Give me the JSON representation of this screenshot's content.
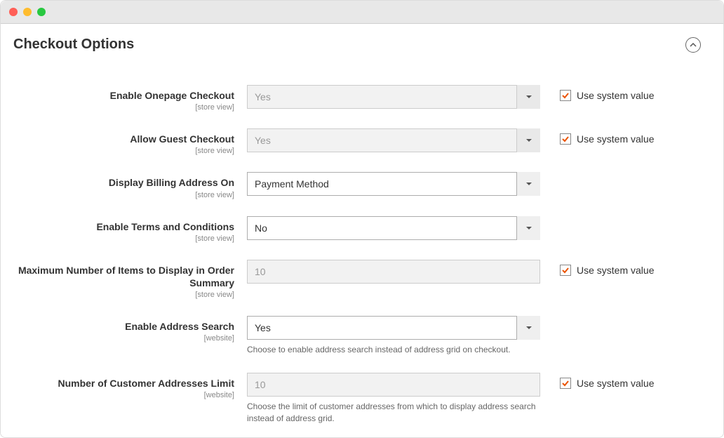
{
  "section_title": "Checkout Options",
  "use_system_value_label": "Use system value",
  "scopes": {
    "store_view": "[store view]",
    "website": "[website]"
  },
  "fields": {
    "enable_onepage": {
      "label": "Enable Onepage Checkout",
      "scope": "[store view]",
      "value": "Yes"
    },
    "allow_guest": {
      "label": "Allow Guest Checkout",
      "scope": "[store view]",
      "value": "Yes"
    },
    "billing_address": {
      "label": "Display Billing Address On",
      "scope": "[store view]",
      "value": "Payment Method"
    },
    "terms": {
      "label": "Enable Terms and Conditions",
      "scope": "[store view]",
      "value": "No"
    },
    "max_items": {
      "label": "Maximum Number of Items to Display in Order Summary",
      "scope": "[store view]",
      "value": "10"
    },
    "address_search": {
      "label": "Enable Address Search",
      "scope": "[website]",
      "value": "Yes",
      "help": "Choose to enable address search instead of address grid on checkout."
    },
    "address_limit": {
      "label": "Number of Customer Addresses Limit",
      "scope": "[website]",
      "value": "10",
      "help": "Choose the limit of customer addresses from which to display address search instead of address grid."
    }
  }
}
